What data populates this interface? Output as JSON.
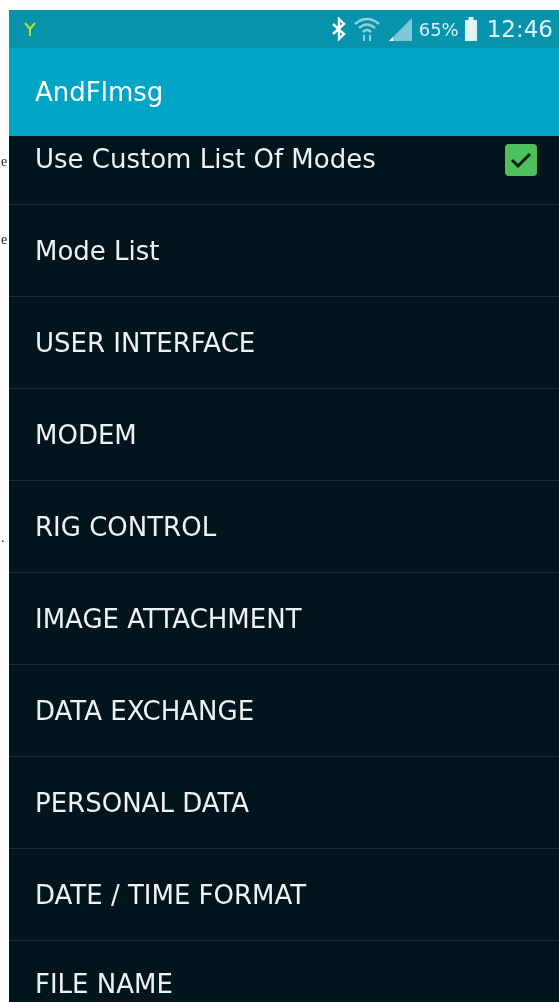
{
  "margin_fragments": [
    "e",
    "e",
    "."
  ],
  "status_bar": {
    "battery": "65%",
    "time": "12:46"
  },
  "app_bar": {
    "title": "AndFlmsg"
  },
  "items": [
    {
      "kind": "checkbox",
      "label": "Use Custom List Of Modes",
      "checked": true
    },
    {
      "kind": "plain",
      "label": "Mode List"
    },
    {
      "kind": "plain",
      "label": "USER INTERFACE"
    },
    {
      "kind": "plain",
      "label": "MODEM"
    },
    {
      "kind": "plain",
      "label": "RIG CONTROL"
    },
    {
      "kind": "plain",
      "label": "IMAGE ATTACHMENT"
    },
    {
      "kind": "plain",
      "label": "DATA EXCHANGE"
    },
    {
      "kind": "plain",
      "label": "PERSONAL DATA"
    },
    {
      "kind": "plain",
      "label": "DATE / TIME FORMAT"
    },
    {
      "kind": "plain",
      "label": "FILE NAME"
    }
  ]
}
